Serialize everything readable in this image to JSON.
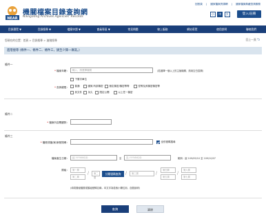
{
  "header": {
    "title_cn": "機關檔案目錄查詢網",
    "title_en": "Navigating Archives Agencies' Records",
    "links": [
      "回首頁",
      "國家檔案資源網",
      "國家檔案典藏查詢服務"
    ],
    "font_sizes": [
      "小",
      "中",
      "大"
    ],
    "login_label": "登入/註冊"
  },
  "nav": {
    "items": [
      "目錄瀏覽 ▼",
      "目錄搜尋 ▼",
      "檔案申請 ▼",
      "會員專區 ▼",
      "常見問題",
      "線上服務",
      "網站導覽",
      "使用說明",
      "聯絡我們"
    ]
  },
  "breadcrumb": "您現在的位置：首頁 > 目錄搜尋 > 進階搜尋",
  "back_label": "回上一頁",
  "title": "進階搜尋 (條件一、條件二、條件三，請至少擇一填寫。)",
  "sections": {
    "cond1": "條件一",
    "cond2": "條件二",
    "cond3": "條件三"
  },
  "form": {
    "agency_label": "檔案年籍：",
    "agency_placeholder": "輸入、請選擇機關",
    "agency_note": "(若選擇一個以上的主管機關，請用空白區隔)",
    "sub_unit_label": "下層次單位",
    "sub_unit_checked": true,
    "category_label": "查詢權限：",
    "categories": [
      "普通",
      "國家/內部機密",
      "極定機密/機密等等",
      "密等及其機密機密等",
      "其文件",
      "永久",
      "限定公開",
      "以上任一機密"
    ],
    "keyword_label": "檔案內容關鍵詞：",
    "doc_label": "檔號或檔/案/案號搜尋：",
    "exact_label": "全形號碼搜尋",
    "exact_checked": true,
    "date_label": "檔案產生日期：",
    "date_from_placeholder": "起 YYYMMDD",
    "date_to_sep": "至",
    "date_to_placeholder": "迄 YYYMMDD",
    "date_example": "範例：起 109/09/10 至 109/10/07",
    "level_label": "層級：",
    "level_items": [
      "第一層",
      "第二層",
      "分類號碼查詢",
      "第三層",
      "第四層",
      "第五層",
      "第六層",
      "第七層",
      "第八層",
      "第九層",
      "第十層"
    ],
    "level_note": "(填寫層級階層或類組號碼名稱，本文字為檢索小欄位用，自動說明)"
  },
  "buttons": {
    "search": "查詢",
    "clear": "清除"
  },
  "colors": {
    "primary": "#1a3f7a",
    "titlebar": "#d9e4ee"
  }
}
